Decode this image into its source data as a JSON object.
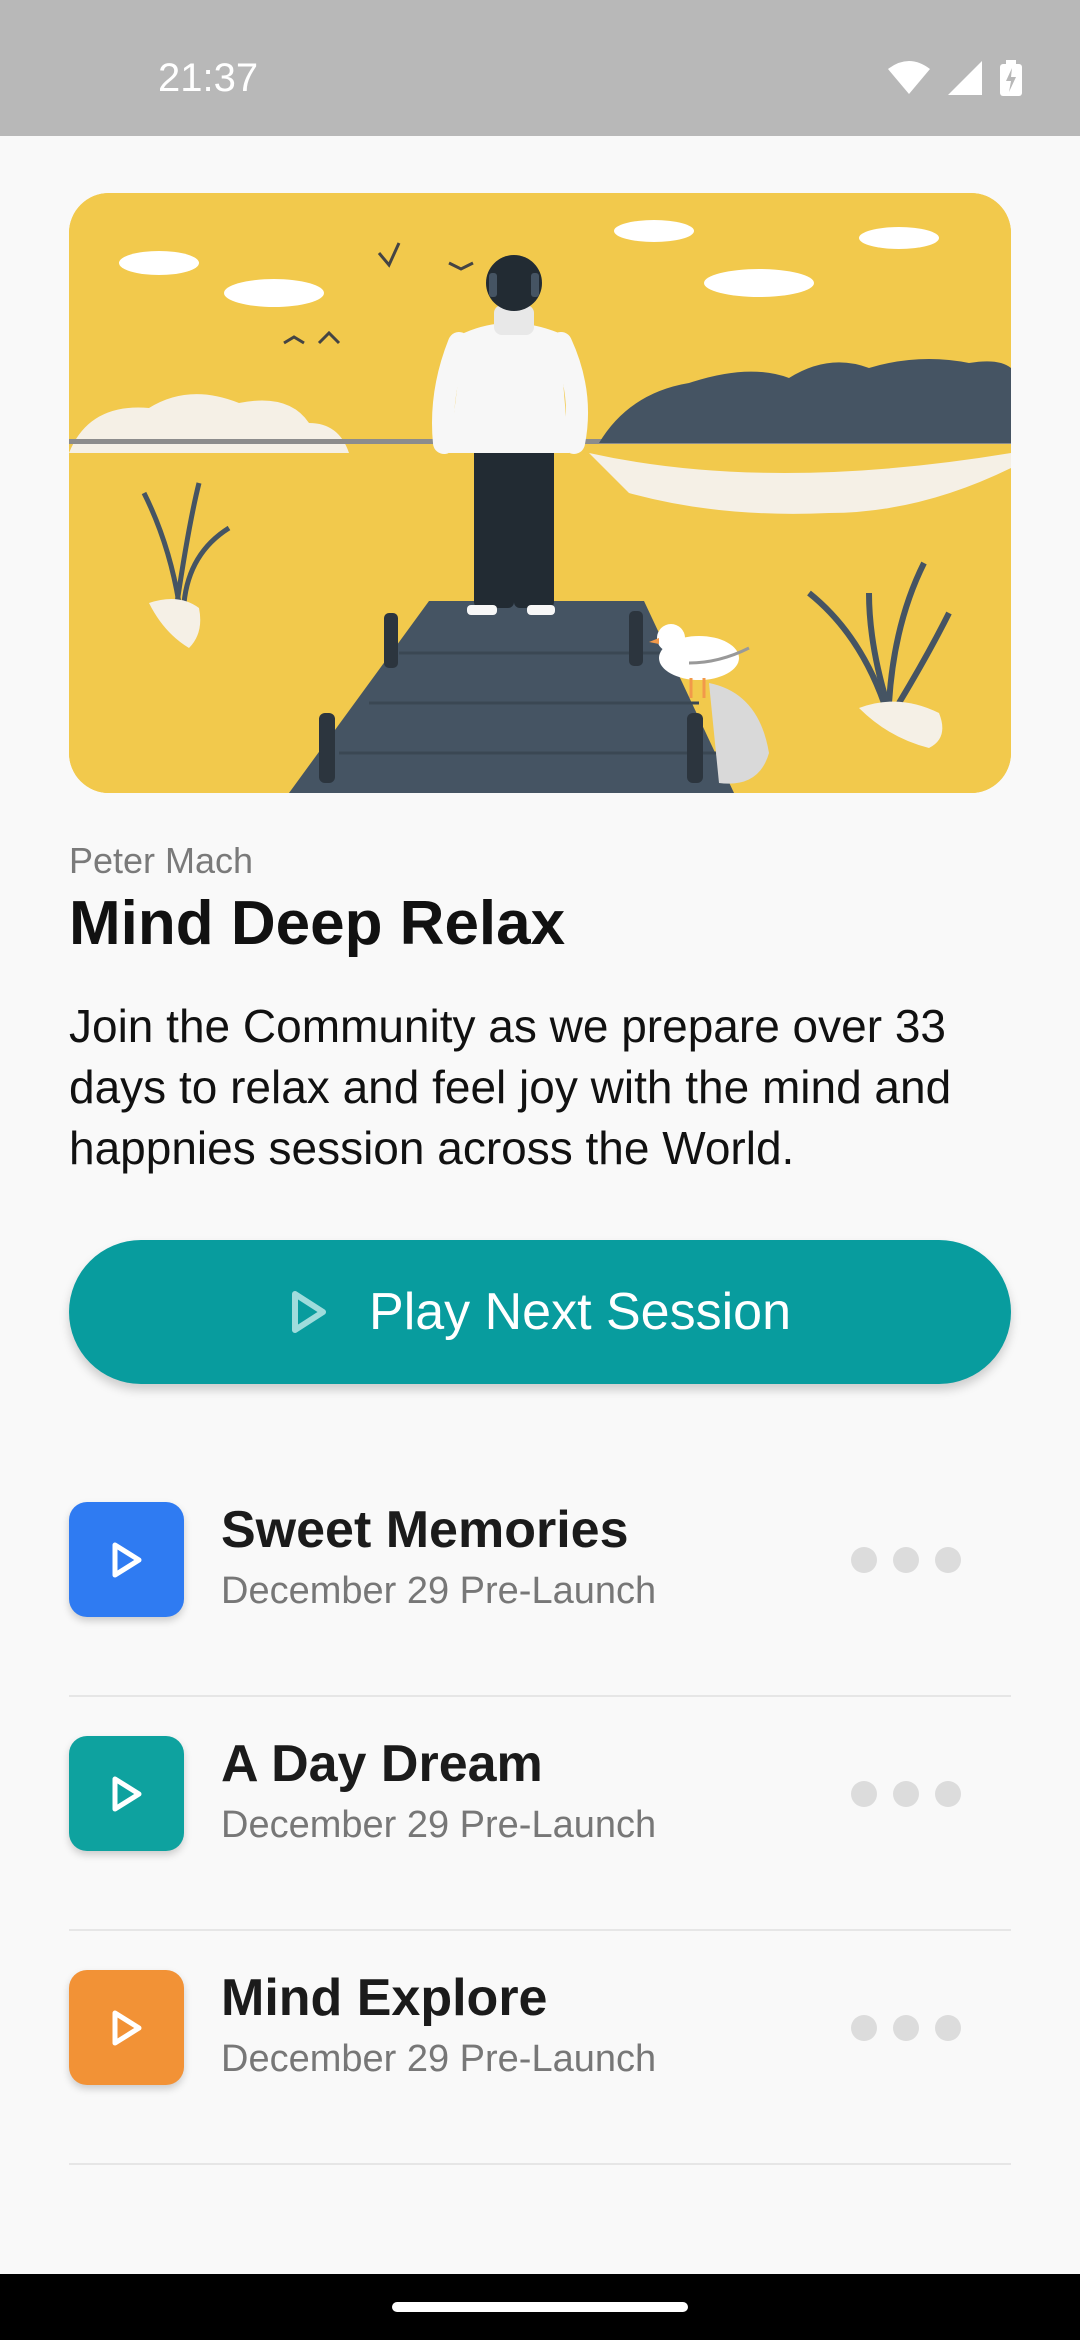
{
  "status_bar": {
    "time": "21:37"
  },
  "card": {
    "author": "Peter Mach",
    "title": "Mind Deep Relax",
    "description": "Join the Community as we prepare over 33 days to relax and feel joy with the mind and happnies session across the World."
  },
  "play_button": {
    "label": "Play Next Session",
    "icon": "play-icon"
  },
  "sessions": [
    {
      "title": "Sweet Memories",
      "subtitle": "December 29 Pre-Launch",
      "color": "#2f7bf2"
    },
    {
      "title": "A Day Dream",
      "subtitle": "December 29 Pre-Launch",
      "color": "#0ea29f"
    },
    {
      "title": "Mind Explore",
      "subtitle": "December 29 Pre-Launch",
      "color": "#f29236"
    }
  ],
  "colors": {
    "accent": "#089c9e",
    "hero_background": "#f2c94c"
  }
}
